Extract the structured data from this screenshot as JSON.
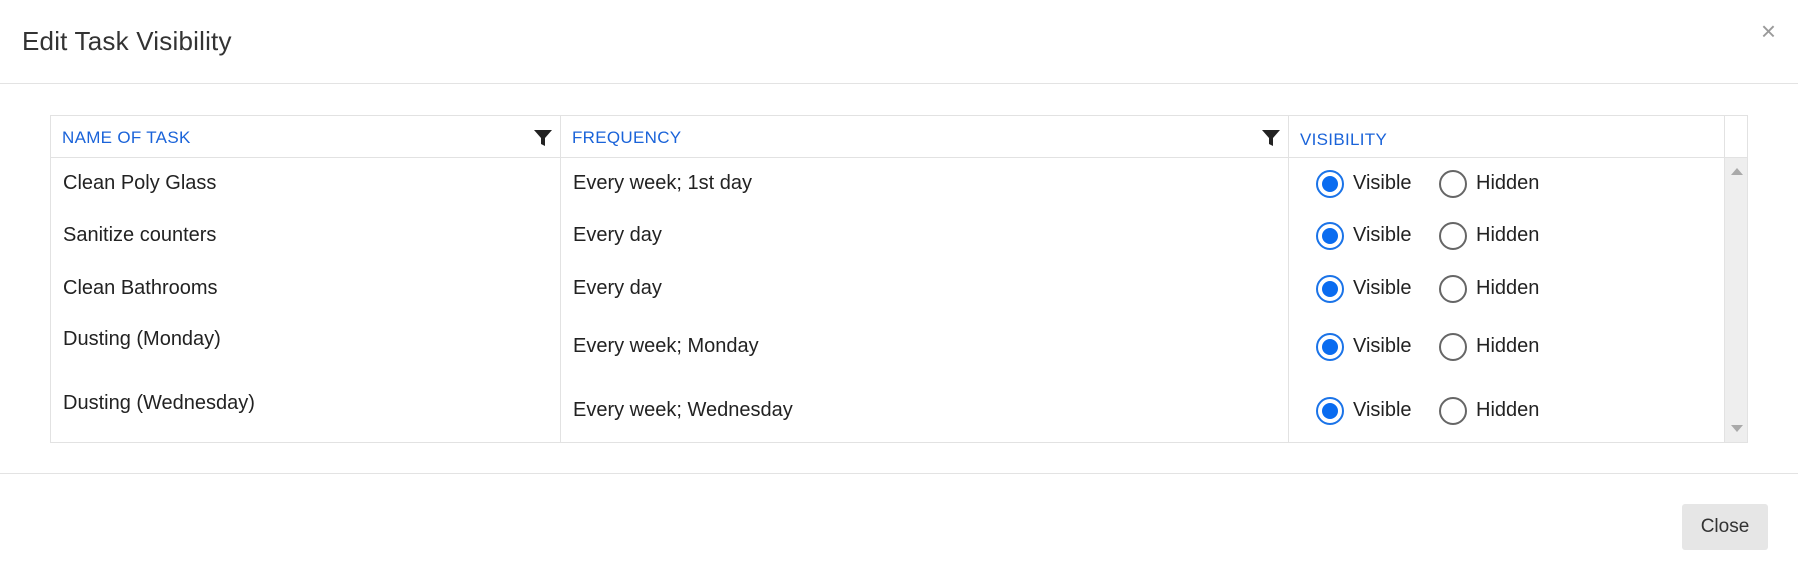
{
  "modal": {
    "title": "Edit Task Visibility",
    "close_icon": "×",
    "close_button_label": "Close"
  },
  "grid": {
    "columns": [
      {
        "label": "NAME OF TASK",
        "filterable": true
      },
      {
        "label": "FREQUENCY",
        "filterable": true
      },
      {
        "label": "VISIBILITY",
        "filterable": false
      }
    ],
    "visibility_options": [
      "Visible",
      "Hidden"
    ],
    "rows": [
      {
        "name": "Clean Poly Glass",
        "frequency": "Every week; 1st day",
        "visibility": "Visible"
      },
      {
        "name": "Sanitize counters",
        "frequency": "Every day",
        "visibility": "Visible"
      },
      {
        "name": "Clean Bathrooms",
        "frequency": "Every day",
        "visibility": "Visible"
      },
      {
        "name": "Dusting (Monday)",
        "frequency": "Every week; Monday",
        "visibility": "Visible"
      },
      {
        "name": "Dusting (Wednesday)",
        "frequency": "Every week; Wednesday",
        "visibility": "Visible"
      }
    ]
  },
  "colors": {
    "accent": "#1a63d9",
    "radio_checked": "#0a6cf0",
    "button_bg": "#e6e6e6"
  }
}
